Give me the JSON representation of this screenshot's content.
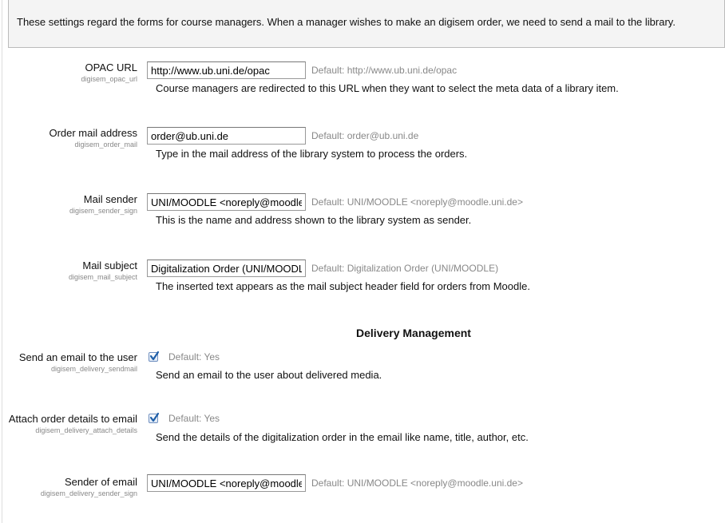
{
  "intro": {
    "text": "These settings regard the forms for course managers. When a manager wishes to make an digisem order, we need to send a mail to the library."
  },
  "settings": [
    {
      "label": "OPAC URL",
      "name": "digisem_opac_url",
      "value": "http://www.ub.uni.de/opac",
      "default": "Default: http://www.ub.uni.de/opac",
      "description": "Course managers are redirected to this URL when they want to select the meta data of a library item."
    },
    {
      "label": "Order mail address",
      "name": "digisem_order_mail",
      "value": "order@ub.uni.de",
      "default": "Default: order@ub.uni.de",
      "description": "Type in the mail address of the library system to process the orders."
    },
    {
      "label": "Mail sender",
      "name": "digisem_sender_sign",
      "value": "UNI/MOODLE <noreply@moodle.",
      "default": "Default: UNI/MOODLE <noreply@moodle.uni.de>",
      "description": "This is the name and address shown to the library system as sender."
    },
    {
      "label": "Mail subject",
      "name": "digisem_mail_subject",
      "value": "Digitalization Order (UNI/MOODLE",
      "default": "Default: Digitalization Order (UNI/MOODLE)",
      "description": "The inserted text appears as the mail subject header field for orders from Moodle."
    }
  ],
  "delivery": {
    "heading": "Delivery Management",
    "sendmail": {
      "label": "Send an email to the user",
      "name": "digisem_delivery_sendmail",
      "checked": true,
      "default": "Default: Yes",
      "description": "Send an email to the user about delivered media."
    },
    "attach_details": {
      "label": "Attach order details to email",
      "name": "digisem_delivery_attach_details",
      "checked": true,
      "default": "Default: Yes",
      "description": "Send the details of the digitalization order in the email like name, title, author, etc."
    },
    "sender_sign": {
      "label": "Sender of email",
      "name": "digisem_delivery_sender_sign",
      "value": "UNI/MOODLE <noreply@moodle.",
      "default": "Default: UNI/MOODLE <noreply@moodle.uni.de>"
    }
  },
  "colors": {
    "checkmark": "#1f5fa8",
    "muted_text": "#888888",
    "intro_background": "#f4f4f4"
  }
}
